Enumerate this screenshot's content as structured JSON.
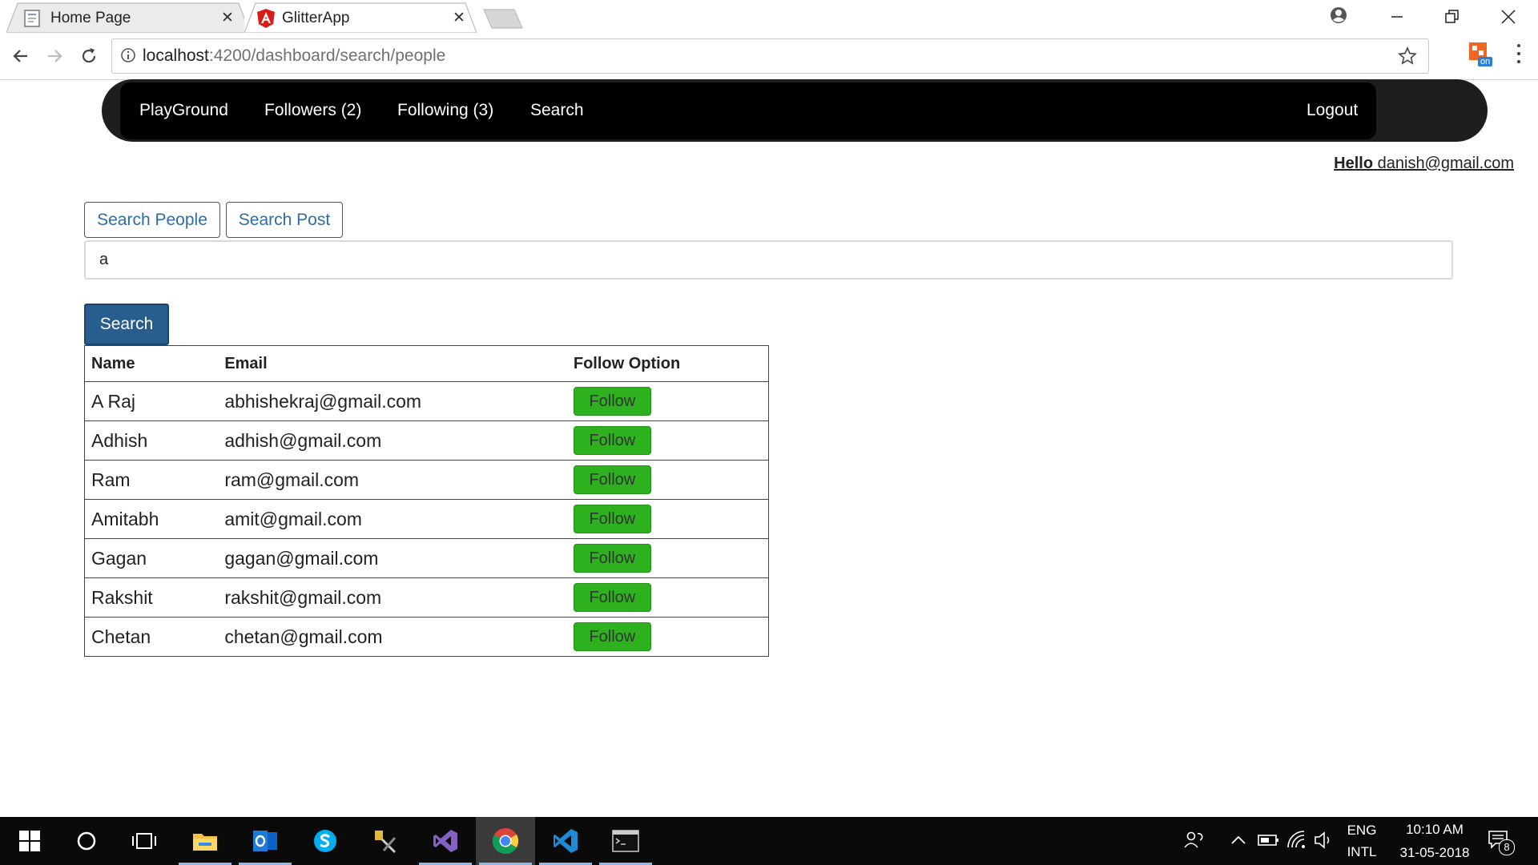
{
  "browser": {
    "tabs": [
      {
        "title": "Home Page",
        "active": false
      },
      {
        "title": "GlitterApp",
        "active": true
      }
    ],
    "url_host": "localhost",
    "url_rest": ":4200/dashboard/search/people",
    "extension_badge": "on"
  },
  "navbar": {
    "links": [
      "PlayGround",
      "Followers (2)",
      "Following (3)",
      "Search"
    ],
    "logout": "Logout"
  },
  "greeting": {
    "hello": "Hello",
    "email": "danish@gmail.com"
  },
  "search": {
    "tabs": [
      "Search People",
      "Search Post"
    ],
    "query": "a",
    "button": "Search"
  },
  "table": {
    "headers": [
      "Name",
      "Email",
      "Follow Option"
    ],
    "rows": [
      {
        "name": "A Raj",
        "email": "abhishekraj@gmail.com",
        "action": "Follow"
      },
      {
        "name": "Adhish",
        "email": "adhish@gmail.com",
        "action": "Follow"
      },
      {
        "name": "Ram",
        "email": "ram@gmail.com",
        "action": "Follow"
      },
      {
        "name": "Amitabh",
        "email": "amit@gmail.com",
        "action": "Follow"
      },
      {
        "name": "Gagan",
        "email": "gagan@gmail.com",
        "action": "Follow"
      },
      {
        "name": "Rakshit",
        "email": "rakshit@gmail.com",
        "action": "Follow"
      },
      {
        "name": "Chetan",
        "email": "chetan@gmail.com",
        "action": "Follow"
      }
    ]
  },
  "taskbar": {
    "lang_top": "ENG",
    "lang_bottom": "INTL",
    "time": "10:10 AM",
    "date": "31-05-2018",
    "notification_count": "8"
  },
  "colors": {
    "navbar": "#000000",
    "follow_button": "#2db11e",
    "search_button": "#285e8e",
    "link": "#2e6da4"
  }
}
